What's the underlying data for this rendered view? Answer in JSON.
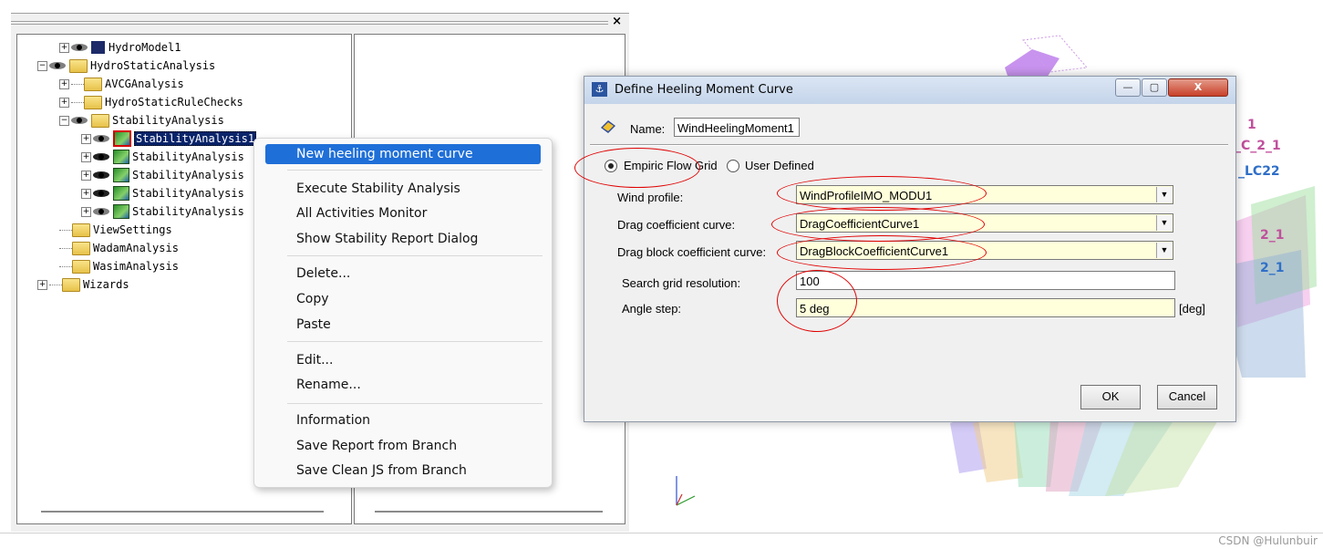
{
  "tree": {
    "items": [
      {
        "label": "HydroModel1",
        "expander": "+"
      },
      {
        "label": "HydroStaticAnalysis",
        "expander": "−"
      },
      {
        "label": "AVCGAnalysis",
        "expander": "+"
      },
      {
        "label": "HydroStaticRuleChecks",
        "expander": "+"
      },
      {
        "label": "StabilityAnalysis",
        "expander": "−"
      },
      {
        "label": "StabilityAnalysis1",
        "expander": "+"
      },
      {
        "label": "StabilityAnalysis",
        "expander": "+"
      },
      {
        "label": "StabilityAnalysis",
        "expander": "+"
      },
      {
        "label": "StabilityAnalysis",
        "expander": "+"
      },
      {
        "label": "StabilityAnalysis",
        "expander": "+"
      },
      {
        "label": "ViewSettings",
        "expander": ""
      },
      {
        "label": "WadamAnalysis",
        "expander": ""
      },
      {
        "label": "WasimAnalysis",
        "expander": ""
      },
      {
        "label": "Wizards",
        "expander": "+"
      }
    ]
  },
  "panel": {
    "close_glyph": "×"
  },
  "context_menu": {
    "items": [
      "New heeling moment curve",
      "Execute Stability Analysis",
      "All Activities Monitor",
      "Show Stability Report Dialog",
      "Delete...",
      "Copy",
      "Paste",
      "Edit...",
      "Rename...",
      "Information",
      "Save Report from Branch",
      "Save Clean JS from Branch"
    ]
  },
  "dialog": {
    "title": "Define Heeling Moment Curve",
    "title_buttons": {
      "minimize": "—",
      "maximize": "▢",
      "close": "X"
    },
    "name_label": "Name:",
    "name_value": "WindHeelingMoment1",
    "radio_empiric": "Empiric Flow Grid",
    "radio_user": "User Defined",
    "wind_profile_label": "Wind profile:",
    "wind_profile_value": "WindProfileIMO_MODU1",
    "drag_coef_label": "Drag coefficient curve:",
    "drag_coef_value": "DragCoefficientCurve1",
    "drag_block_label": "Drag block coefficient curve:",
    "drag_block_value": "DragBlockCoefficientCurve1",
    "search_grid_label": "Search grid resolution:",
    "search_grid_value": "100",
    "angle_step_label": "Angle step:",
    "angle_step_value": "5 deg",
    "angle_unit": "[deg]",
    "ok": "OK",
    "cancel": "Cancel",
    "dropdown_arrow": "▼"
  },
  "view3d": {
    "labels": [
      {
        "text": "1",
        "color": "#c0509c"
      },
      {
        "text": "_C_2_1",
        "color": "#c0509c"
      },
      {
        "text": "_LC22",
        "color": "#2f6fc8"
      },
      {
        "text": "2_1",
        "color": "#c0509c"
      },
      {
        "text": "2_1",
        "color": "#2f6fc8"
      }
    ]
  },
  "watermark": "CSDN @Hulunbuir"
}
